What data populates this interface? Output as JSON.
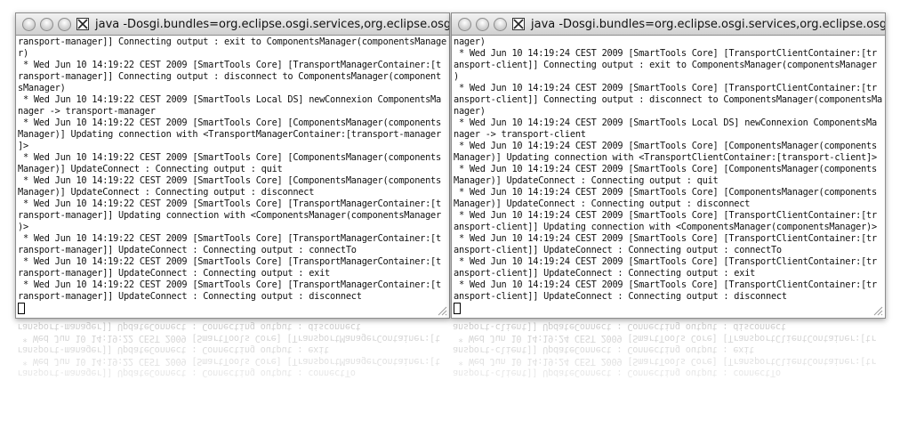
{
  "windows": [
    {
      "title": "java -Dosgi.bundles=org.eclipse.osgi.services,org.eclipse.osg",
      "lines": [
        "ransport-manager]] Connecting output : exit to ComponentsManager(componentsManager",
        "r)",
        " * Wed Jun 10 14:19:22 CEST 2009 [SmartTools Core] [TransportManagerContainer:[t",
        "ransport-manager]] Connecting output : disconnect to ComponentsManager(component",
        "sManager)",
        " * Wed Jun 10 14:19:22 CEST 2009 [SmartTools Local DS] newConnexion ComponentsMa",
        "nager -> transport-manager",
        " * Wed Jun 10 14:19:22 CEST 2009 [SmartTools Core] [ComponentsManager(components",
        "Manager)] Updating connection with <TransportManagerContainer:[transport-manager",
        "]>",
        " * Wed Jun 10 14:19:22 CEST 2009 [SmartTools Core] [ComponentsManager(components",
        "Manager)] UpdateConnect : Connecting output : quit",
        " * Wed Jun 10 14:19:22 CEST 2009 [SmartTools Core] [ComponentsManager(components",
        "Manager)] UpdateConnect : Connecting output : disconnect",
        " * Wed Jun 10 14:19:22 CEST 2009 [SmartTools Core] [TransportManagerContainer:[t",
        "ransport-manager]] Updating connection with <ComponentsManager(componentsManager",
        ")>",
        " * Wed Jun 10 14:19:22 CEST 2009 [SmartTools Core] [TransportManagerContainer:[t",
        "ransport-manager]] UpdateConnect : Connecting output : connectTo",
        " * Wed Jun 10 14:19:22 CEST 2009 [SmartTools Core] [TransportManagerContainer:[t",
        "ransport-manager]] UpdateConnect : Connecting output : exit",
        " * Wed Jun 10 14:19:22 CEST 2009 [SmartTools Core] [TransportManagerContainer:[t",
        "ransport-manager]] UpdateConnect : Connecting output : disconnect"
      ]
    },
    {
      "title": "java -Dosgi.bundles=org.eclipse.osgi.services,org.eclipse.osg",
      "lines": [
        "nager)",
        " * Wed Jun 10 14:19:24 CEST 2009 [SmartTools Core] [TransportClientContainer:[tr",
        "ansport-client]] Connecting output : exit to ComponentsManager(componentsManager",
        ")",
        " * Wed Jun 10 14:19:24 CEST 2009 [SmartTools Core] [TransportClientContainer:[tr",
        "ansport-client]] Connecting output : disconnect to ComponentsManager(componentsMa",
        "nager)",
        " * Wed Jun 10 14:19:24 CEST 2009 [SmartTools Local DS] newConnexion ComponentsMa",
        "nager -> transport-client",
        " * Wed Jun 10 14:19:24 CEST 2009 [SmartTools Core] [ComponentsManager(components",
        "Manager)] Updating connection with <TransportClientContainer:[transport-client]>",
        " * Wed Jun 10 14:19:24 CEST 2009 [SmartTools Core] [ComponentsManager(components",
        "Manager)] UpdateConnect : Connecting output : quit",
        " * Wed Jun 10 14:19:24 CEST 2009 [SmartTools Core] [ComponentsManager(components",
        "Manager)] UpdateConnect : Connecting output : disconnect",
        " * Wed Jun 10 14:19:24 CEST 2009 [SmartTools Core] [TransportClientContainer:[tr",
        "ansport-client]] Updating connection with <ComponentsManager(componentsManager)>",
        " * Wed Jun 10 14:19:24 CEST 2009 [SmartTools Core] [TransportClientContainer:[tr",
        "ansport-client]] UpdateConnect : Connecting output : connectTo",
        " * Wed Jun 10 14:19:24 CEST 2009 [SmartTools Core] [TransportClientContainer:[tr",
        "ansport-client]] UpdateConnect : Connecting output : exit",
        " * Wed Jun 10 14:19:24 CEST 2009 [SmartTools Core] [TransportClientContainer:[tr",
        "ansport-client]] UpdateConnect : Connecting output : disconnect"
      ]
    }
  ],
  "colors": {
    "titlebar_top": "#f2f2f2",
    "titlebar_bottom": "#d0d0d0",
    "terminal_bg": "#ffffff",
    "terminal_text": "#111111"
  },
  "icons": [
    "close-button",
    "minimize-button",
    "zoom-button",
    "x11-icon",
    "resize-grip-icon",
    "text-cursor"
  ]
}
